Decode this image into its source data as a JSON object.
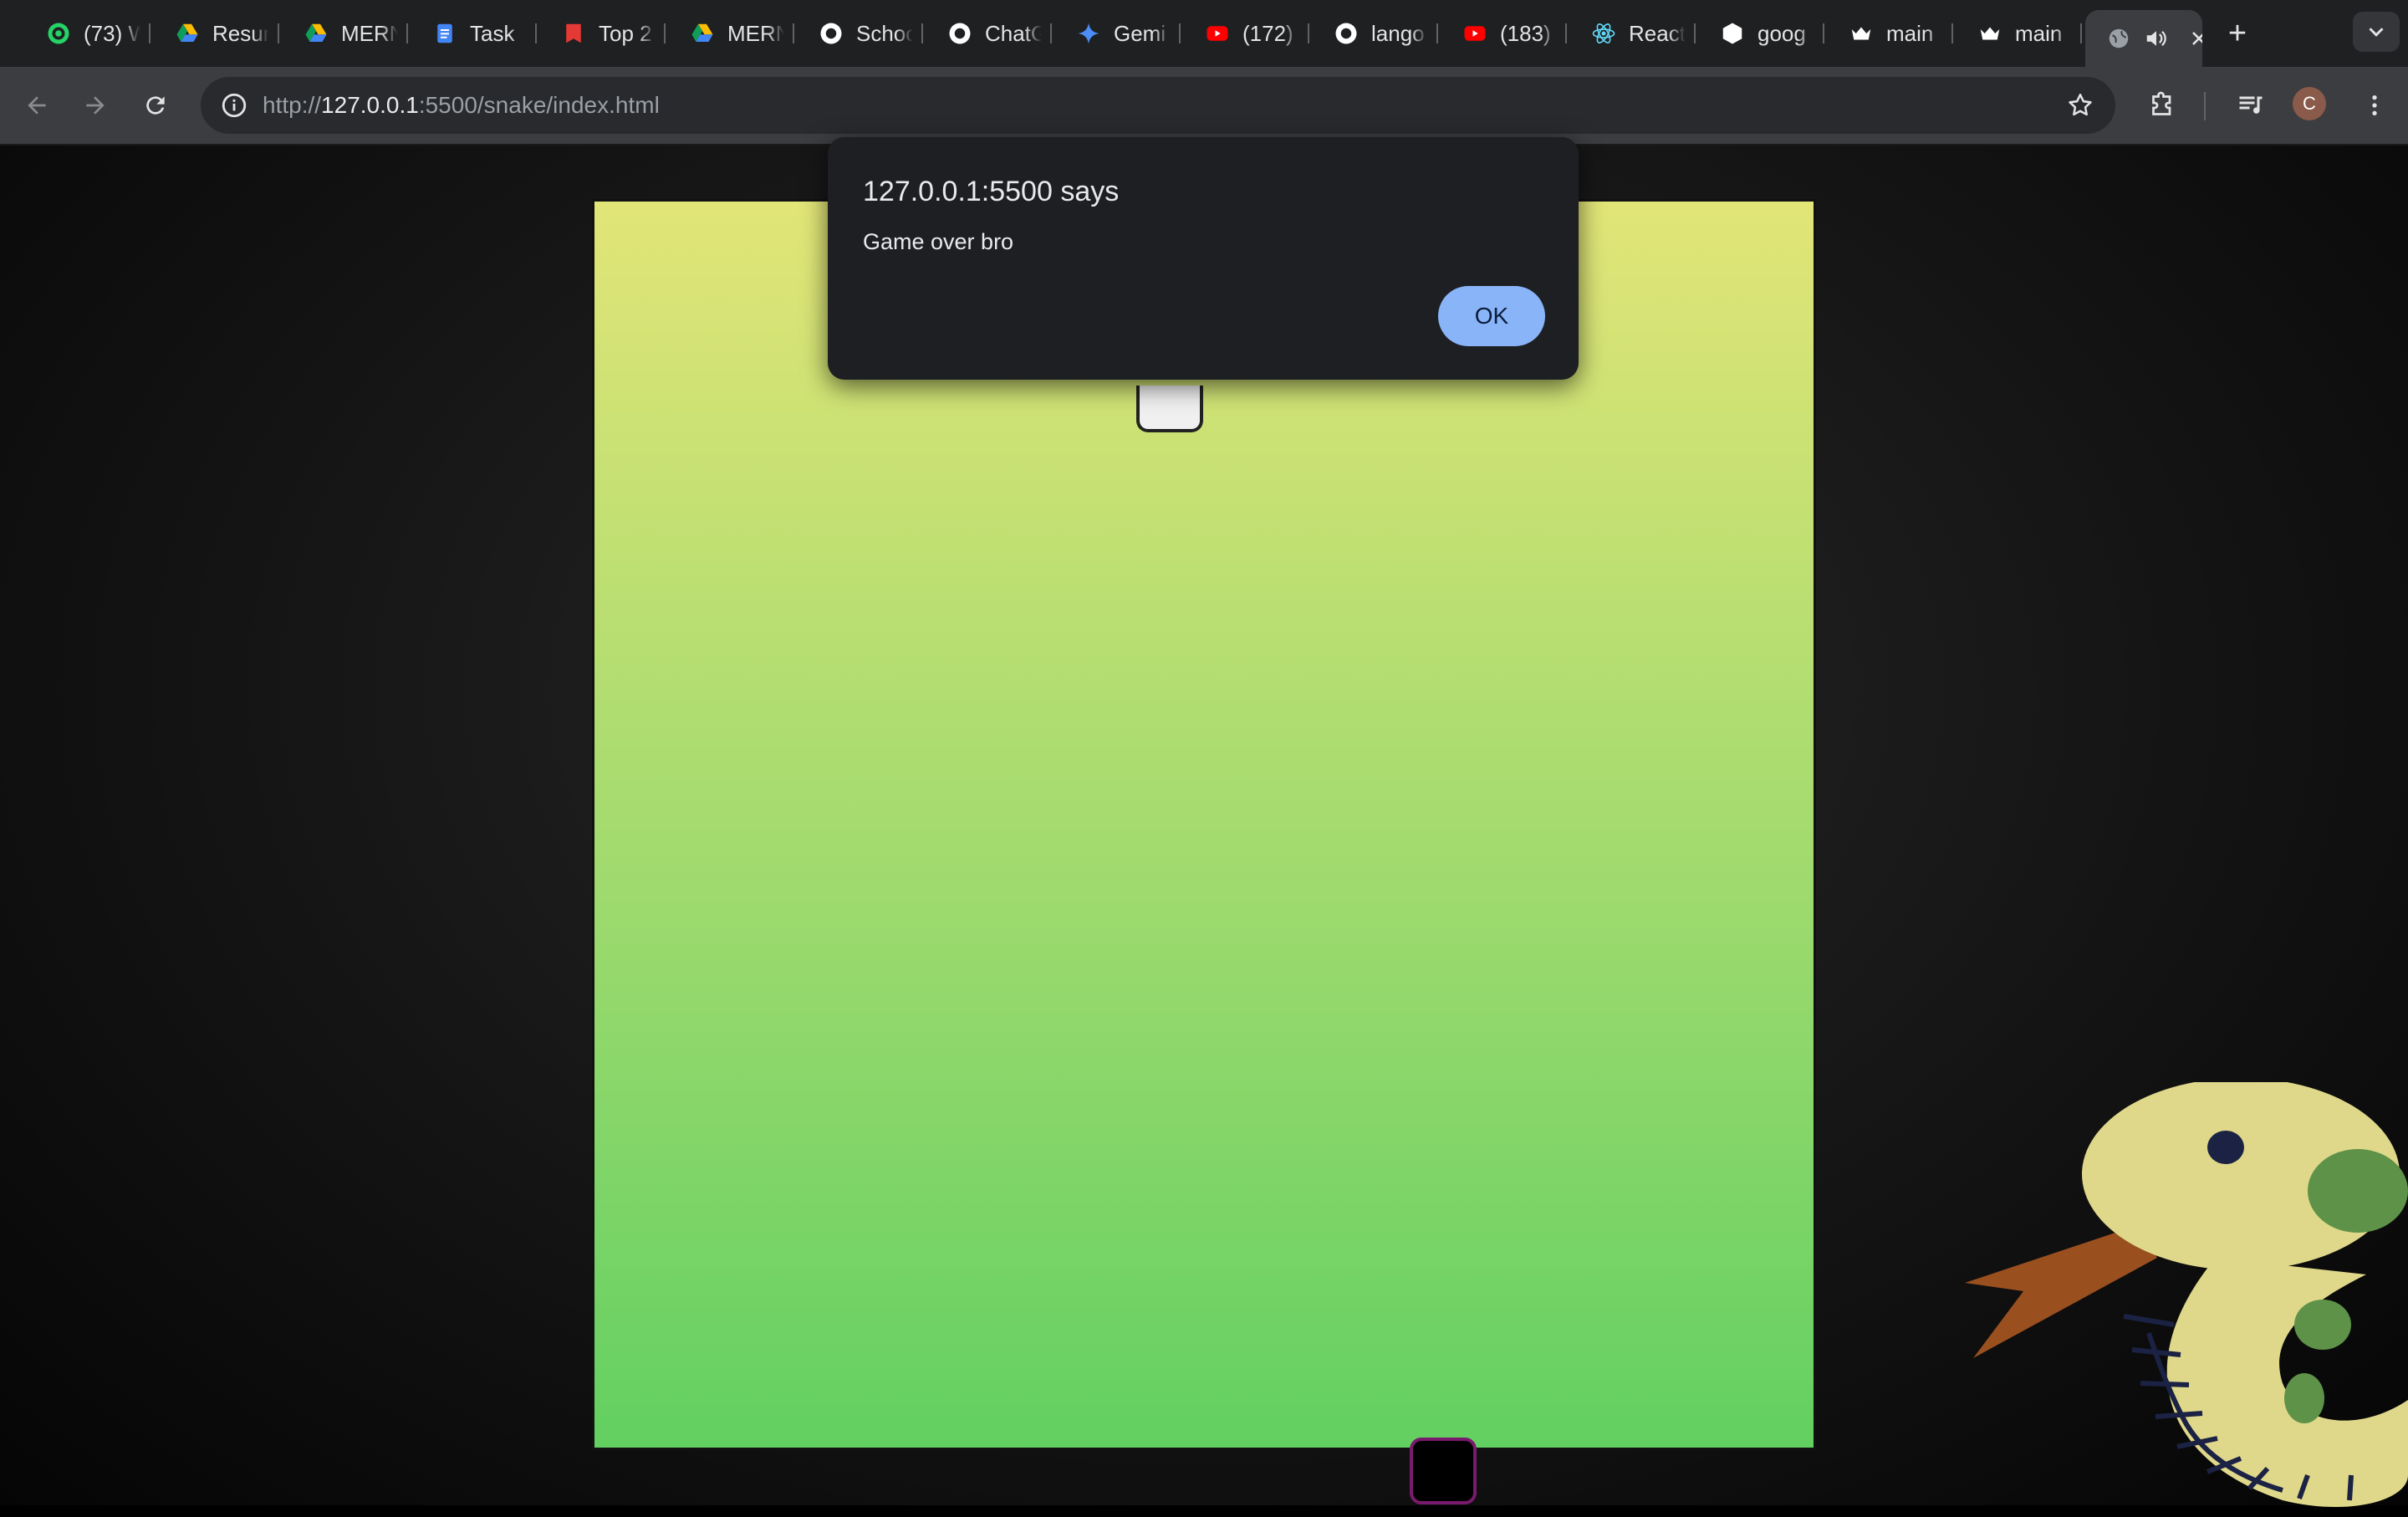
{
  "tabs": [
    {
      "label": "(73) W",
      "icon": "whatsapp-icon",
      "color": "#25d366"
    },
    {
      "label": "Resume",
      "icon": "google-drive-icon",
      "color": "#fbbc04"
    },
    {
      "label": "MERN",
      "icon": "google-drive-icon",
      "color": "#fbbc04"
    },
    {
      "label": "Task",
      "icon": "google-docs-icon",
      "color": "#4285f4"
    },
    {
      "label": "Top 2",
      "icon": "bookmark-red-icon",
      "color": "#e53935"
    },
    {
      "label": "MERN",
      "icon": "google-drive-icon",
      "color": "#fbbc04"
    },
    {
      "label": "School",
      "icon": "github-icon",
      "color": "#ffffff"
    },
    {
      "label": "ChatG",
      "icon": "chatgpt-icon",
      "color": "#ffffff"
    },
    {
      "label": "Gemi",
      "icon": "gemini-icon",
      "color": "#4c8df6"
    },
    {
      "label": "(172)",
      "icon": "youtube-icon",
      "color": "#ff0000"
    },
    {
      "label": "lango",
      "icon": "github-icon",
      "color": "#ffffff"
    },
    {
      "label": "(183)",
      "icon": "youtube-icon",
      "color": "#ff0000"
    },
    {
      "label": "React",
      "icon": "react-icon",
      "color": "#61dafb"
    },
    {
      "label": "goog",
      "icon": "package-icon",
      "color": "#ffffff"
    },
    {
      "label": "main",
      "icon": "crown-icon",
      "color": "#ffffff"
    },
    {
      "label": "main",
      "icon": "crown-icon",
      "color": "#ffffff"
    }
  ],
  "active_tab": {
    "icon": "globe-icon",
    "audio_icon": "speaker-icon",
    "close_icon": "close-icon"
  },
  "toolbar": {
    "url_scheme": "http://",
    "url_host": "127.0.0.1",
    "url_rest": ":5500/snake/index.html",
    "avatar_letter": "C"
  },
  "dialog": {
    "title": "127.0.0.1:5500 says",
    "message": "Game over bro",
    "ok_label": "OK"
  },
  "colors": {
    "board_top": "#e2e577",
    "board_bottom": "#62d061",
    "snake_border": "#7a1a6e",
    "ok_button": "#8ab4f8"
  }
}
